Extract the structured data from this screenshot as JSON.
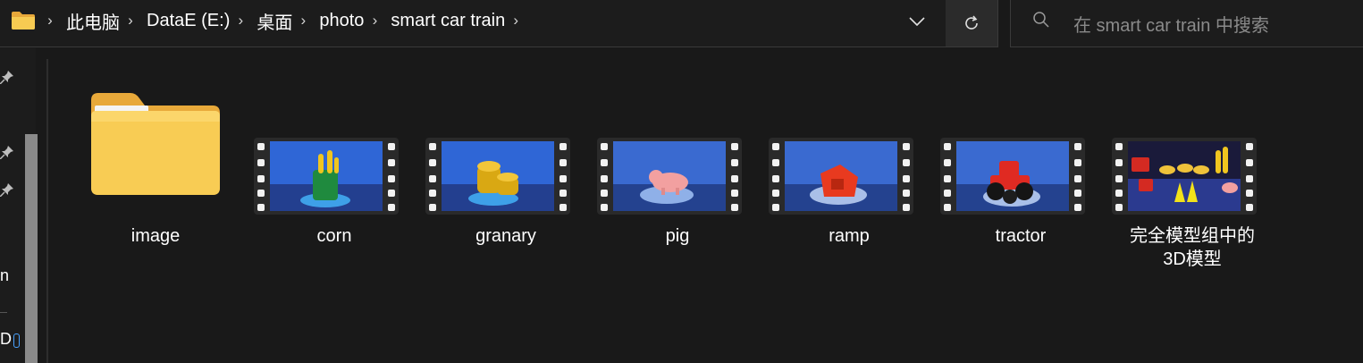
{
  "breadcrumb": [
    "此电脑",
    "DataE (E:)",
    "桌面",
    "photo",
    "smart car train"
  ],
  "search": {
    "placeholder": "在 smart car train 中搜索"
  },
  "nav": {
    "partial_label_1": "n",
    "partial_label_2": "D"
  },
  "items": [
    {
      "label": "image",
      "type": "folder",
      "icon": "folder-icon"
    },
    {
      "label": "corn",
      "type": "video",
      "icon": "video-thumbnail"
    },
    {
      "label": "granary",
      "type": "video",
      "icon": "video-thumbnail"
    },
    {
      "label": "pig",
      "type": "video",
      "icon": "video-thumbnail"
    },
    {
      "label": "ramp",
      "type": "video",
      "icon": "video-thumbnail"
    },
    {
      "label": "tractor",
      "type": "video",
      "icon": "video-thumbnail"
    },
    {
      "label_line1": "完全模型组中的",
      "label_line2": "3D模型",
      "type": "video",
      "icon": "video-thumbnail"
    }
  ],
  "colors": {
    "background": "#191919",
    "folder_yellow": "#f7c94a",
    "film_frame": "#2a2a2a",
    "thumb_sky": "#2f66d6",
    "thumb_floor": "#233f8f"
  }
}
